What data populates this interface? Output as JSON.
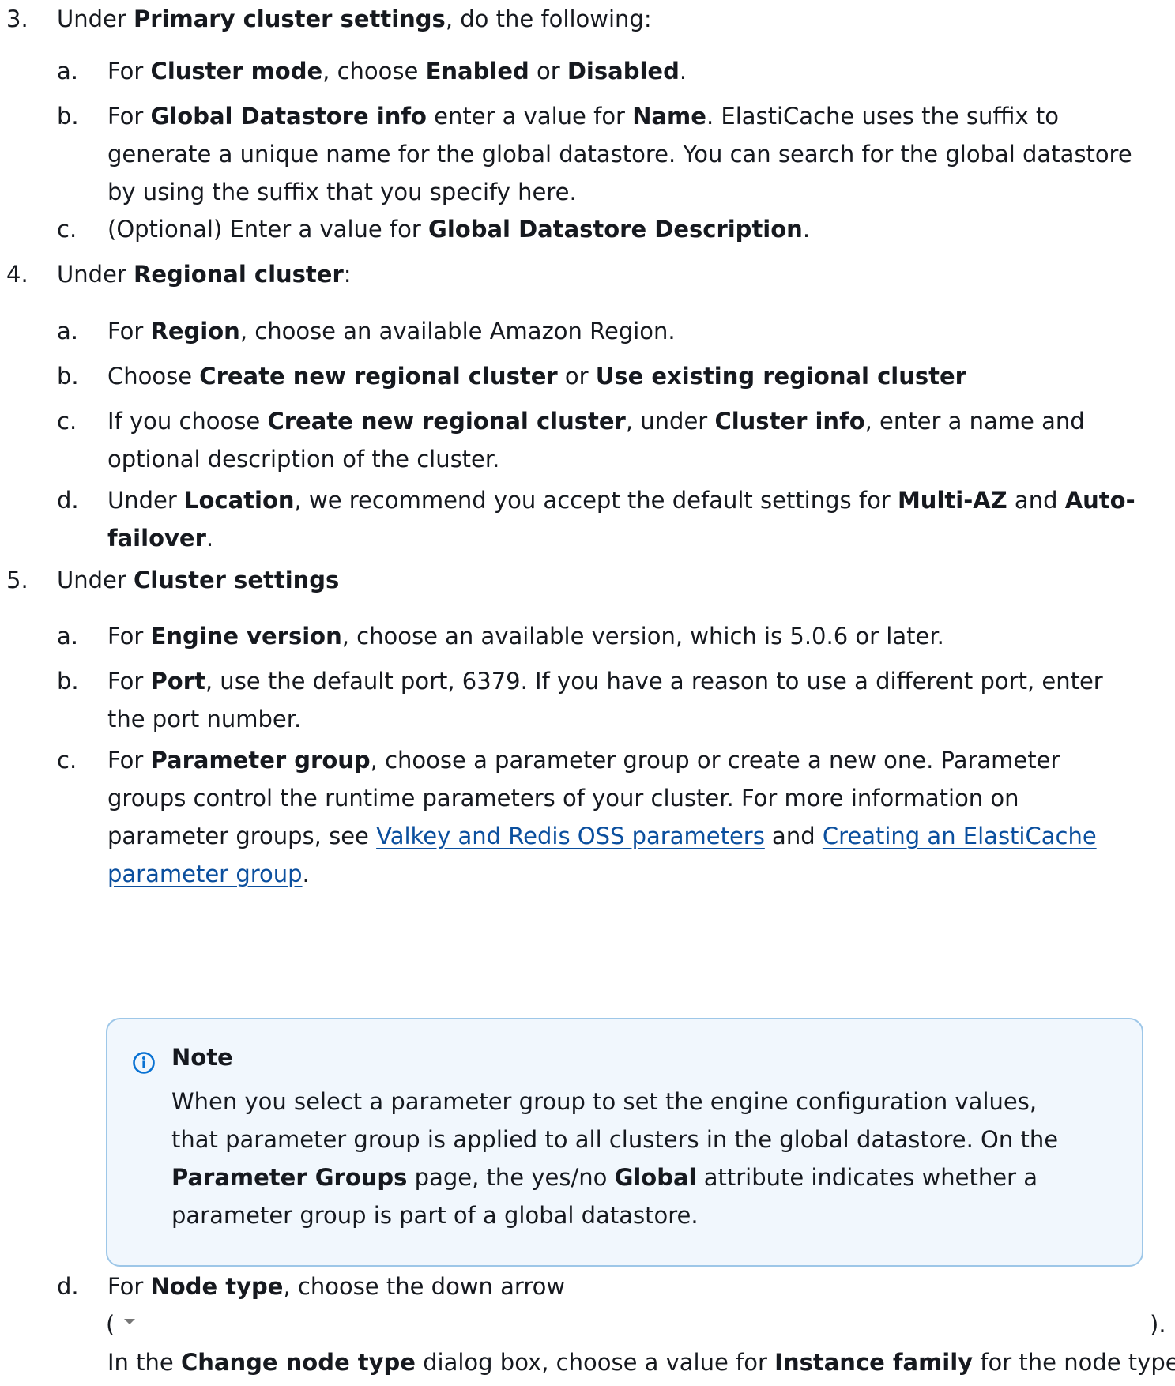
{
  "step3": {
    "num": "3.",
    "parts": [
      "Under ",
      "Primary cluster settings",
      ", do the following:"
    ],
    "a": {
      "num": "a.",
      "parts": [
        "For ",
        "Cluster mode",
        ", choose ",
        "Enabled",
        " or ",
        "Disabled",
        "."
      ]
    },
    "b": {
      "num": "b.",
      "parts": [
        "For ",
        "Global Datastore info",
        " enter a value for ",
        "Name",
        ". ElastiCache uses the suffix to generate a unique name for the global datastore. You can search for the global datastore by using the suffix that you specify here."
      ]
    },
    "c": {
      "num": "c.",
      "parts": [
        "(Optional) Enter a value for ",
        "Global Datastore Description",
        "."
      ]
    }
  },
  "step4": {
    "num": "4.",
    "parts": [
      "Under ",
      "Regional cluster",
      ":"
    ],
    "a": {
      "num": "a.",
      "parts": [
        "For ",
        "Region",
        ", choose an available Amazon Region."
      ]
    },
    "b": {
      "num": "b.",
      "parts": [
        "Choose ",
        "Create new regional cluster",
        " or ",
        "Use existing regional cluster"
      ]
    },
    "c": {
      "num": "c.",
      "parts": [
        "If you choose ",
        "Create new regional cluster",
        ", under ",
        "Cluster info",
        ", enter a name and optional description of the cluster."
      ]
    },
    "d": {
      "num": "d.",
      "parts": [
        "Under ",
        "Location",
        ", we recommend you accept the default settings for ",
        "Multi-AZ",
        " and ",
        "Auto-failover",
        "."
      ]
    }
  },
  "step5": {
    "num": "5.",
    "parts": [
      "Under ",
      "Cluster settings"
    ],
    "a": {
      "num": "a.",
      "parts": [
        "For ",
        "Engine version",
        ", choose an available version, which is 5.0.6 or later."
      ]
    },
    "b": {
      "num": "b.",
      "parts": [
        "For ",
        "Port",
        ", use the default port, 6379. If you have a reason to use a different port, enter the port number."
      ]
    },
    "c": {
      "num": "c.",
      "parts": [
        "For ",
        "Parameter group",
        ", choose a parameter group or create a new one. Parameter groups control the runtime parameters of your cluster. For more information on parameter groups, see "
      ],
      "link1": "Valkey and Redis OSS parameters",
      "and": " and ",
      "link2": "Creating an ElastiCache parameter group",
      "end": "."
    },
    "note": {
      "title": "Note",
      "parts": [
        "When you select a parameter group to set the engine configuration values, that parameter group is applied to all clusters in the global datastore. On the ",
        "Parameter Groups",
        " page, the yes/no ",
        "Global",
        " attribute indicates whether a parameter group is part of a global datastore."
      ]
    },
    "d": {
      "num": "d.",
      "parts": [
        "For ",
        "Node type",
        ", choose the down arrow"
      ],
      "open": "(",
      "close": ").",
      "next": [
        "In the ",
        "Change node type",
        " dialog box, choose a value for ",
        "Instance family",
        " for the node type"
      ]
    }
  }
}
